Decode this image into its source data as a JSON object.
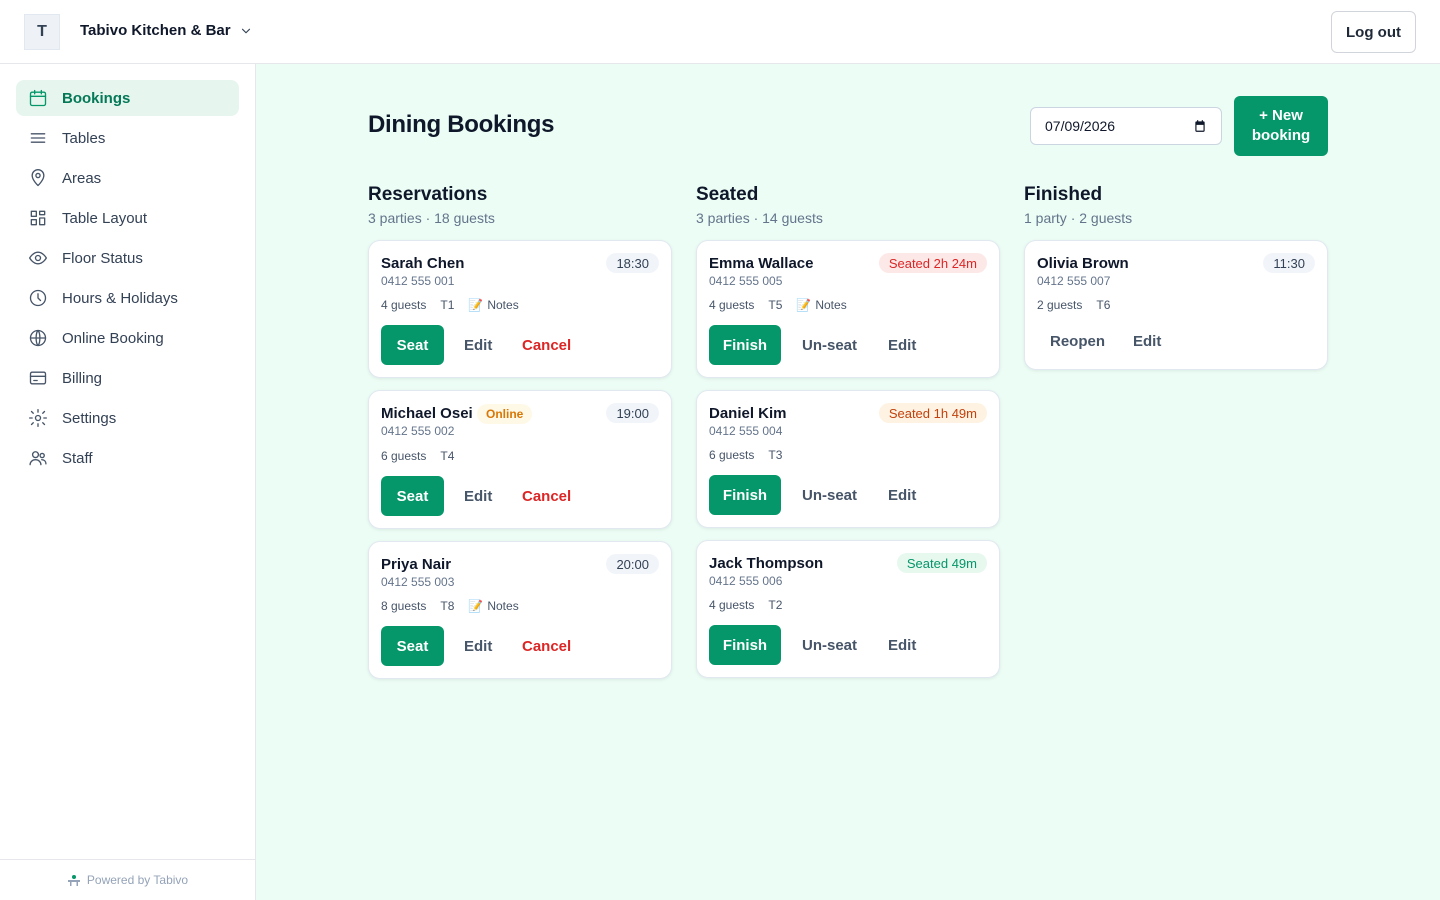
{
  "header": {
    "avatar_letter": "T",
    "restaurant_name": "Tabivo Kitchen & Bar",
    "logout_label": "Log out"
  },
  "sidebar": {
    "items": [
      {
        "label": "Bookings",
        "icon": "calendar-icon",
        "active": true
      },
      {
        "label": "Tables",
        "icon": "menu-lines-icon"
      },
      {
        "label": "Areas",
        "icon": "map-pin-icon"
      },
      {
        "label": "Table Layout",
        "icon": "layout-grid-icon"
      },
      {
        "label": "Floor Status",
        "icon": "eye-icon"
      },
      {
        "label": "Hours & Holidays",
        "icon": "clock-icon"
      },
      {
        "label": "Online Booking",
        "icon": "globe-icon"
      },
      {
        "label": "Billing",
        "icon": "credit-card-icon"
      },
      {
        "label": "Settings",
        "icon": "gear-icon"
      },
      {
        "label": "Staff",
        "icon": "users-icon"
      }
    ],
    "powered_by": "Powered by Tabivo"
  },
  "main": {
    "title": "Dining Bookings",
    "date_value": "07/09/2026",
    "new_booking_label": "+ New booking",
    "columns": {
      "reservations": {
        "title": "Reservations",
        "summary": "3 parties · 18 guests",
        "cards": [
          {
            "name": "Sarah Chen",
            "phone": "0412 555 001",
            "time": "18:30",
            "guests": "4 guests",
            "table": "T1",
            "notes": "Notes",
            "seat": "Seat",
            "edit": "Edit",
            "cancel": "Cancel"
          },
          {
            "name": "Michael Osei",
            "badge": "Online",
            "phone": "0412 555 002",
            "time": "19:00",
            "guests": "6 guests",
            "table": "T4",
            "seat": "Seat",
            "edit": "Edit",
            "cancel": "Cancel"
          },
          {
            "name": "Priya Nair",
            "phone": "0412 555 003",
            "time": "20:00",
            "guests": "8 guests",
            "table": "T8",
            "notes": "Notes",
            "seat": "Seat",
            "edit": "Edit",
            "cancel": "Cancel"
          }
        ]
      },
      "seated": {
        "title": "Seated",
        "summary": "3 parties · 14 guests",
        "cards": [
          {
            "name": "Emma Wallace",
            "phone": "0412 555 005",
            "status": "Seated 2h 24m",
            "status_color": "#dc2626",
            "guests": "4 guests",
            "table": "T5",
            "notes": "Notes",
            "finish": "Finish",
            "unseat": "Un-seat",
            "edit": "Edit"
          },
          {
            "name": "Daniel Kim",
            "phone": "0412 555 004",
            "status": "Seated 1h 49m",
            "status_color": "#c2410c",
            "guests": "6 guests",
            "table": "T3",
            "finish": "Finish",
            "unseat": "Un-seat",
            "edit": "Edit"
          },
          {
            "name": "Jack Thompson",
            "phone": "0412 555 006",
            "status": "Seated 49m",
            "status_color": "#059669",
            "guests": "4 guests",
            "table": "T2",
            "finish": "Finish",
            "unseat": "Un-seat",
            "edit": "Edit"
          }
        ]
      },
      "finished": {
        "title": "Finished",
        "summary": "1 party · 2 guests",
        "cards": [
          {
            "name": "Olivia Brown",
            "phone": "0412 555 007",
            "time": "11:30",
            "guests": "2 guests",
            "table": "T6",
            "reopen": "Reopen",
            "edit": "Edit"
          }
        ]
      }
    }
  },
  "colors": {
    "accent": "#059669",
    "main_bg": "#ecfdf5",
    "danger": "#dc2626"
  }
}
